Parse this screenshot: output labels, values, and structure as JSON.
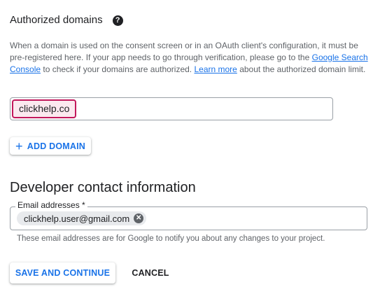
{
  "authorized_domains": {
    "title": "Authorized domains",
    "help_icon": "help-icon",
    "description_1": "When a domain is used on the consent screen or in an OAuth client's configuration, it must be pre-registered here. If your app needs to go through verification, please go to the ",
    "link_search_console": "Google Search Console",
    "description_2": " to check if your domains are authorized. ",
    "link_learn_more": "Learn more",
    "description_3": " about the authorized domain limit.",
    "domain_value": "clickhelp.co",
    "add_domain_label": "ADD DOMAIN"
  },
  "developer_contact": {
    "title": "Developer contact information",
    "email_label": "Email addresses *",
    "email_chip": "clickhelp.user@gmail.com",
    "hint": "These email addresses are for Google to notify you about any changes to your project."
  },
  "actions": {
    "save_label": "SAVE AND CONTINUE",
    "cancel_label": "CANCEL"
  },
  "colors": {
    "accent": "#1a73e8",
    "highlight_border": "#c2185b",
    "text": "#202124",
    "muted": "#5f6368"
  }
}
